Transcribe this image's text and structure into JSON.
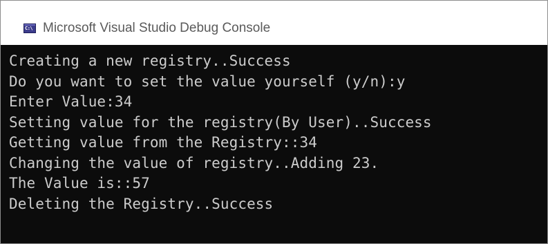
{
  "window": {
    "title": "Microsoft Visual Studio Debug Console",
    "icon": "console-app-icon",
    "icon_glyph": "C:\\"
  },
  "colors": {
    "console_background": "#0c0c0c",
    "console_text": "#cccccc",
    "titlebar_background": "#ffffff",
    "title_text": "#5a5a5a"
  },
  "console": {
    "lines": [
      "Creating a new registry..Success",
      "Do you want to set the value yourself (y/n):y",
      "Enter Value:34",
      "Setting value for the registry(By User)..Success",
      "Getting value from the Registry::34",
      "Changing the value of registry..Adding 23.",
      "The Value is::57",
      "Deleting the Registry..Success"
    ]
  }
}
